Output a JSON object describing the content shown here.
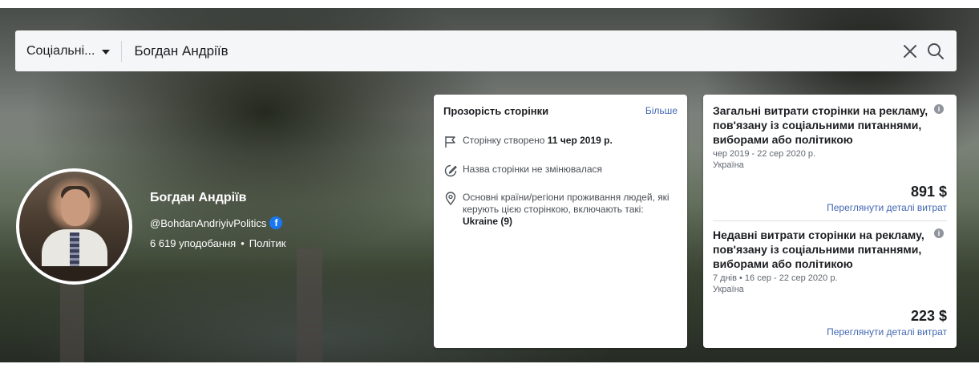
{
  "search": {
    "category": "Соціальні...",
    "query": "Богдан Андріїв"
  },
  "profile": {
    "name": "Богдан Андріїв",
    "handle": "@BohdanAndriyivPolitics",
    "likes": "6 619 уподобання",
    "separator": "•",
    "category": "Політик"
  },
  "transparency": {
    "title": "Прозорість сторінки",
    "more_label": "Більше",
    "created_prefix": "Сторінку створено",
    "created_date": "11 чер 2019 р.",
    "name_unchanged": "Назва сторінки не змінювалася",
    "countries_text": "Основні країни/регіони проживання людей, які керують цією сторінкою, включають такі:",
    "countries_value": "Ukraine (9)"
  },
  "spend": {
    "total": {
      "title": "Загальні витрати сторінки на рекламу, пов'язану із соціальними питаннями, виборами або політикою",
      "period": "чер 2019 - 22 сер 2020 р.",
      "country": "Україна",
      "amount": "891 $",
      "link": "Переглянути деталі витрат"
    },
    "recent": {
      "title": "Недавні витрати сторінки на рекламу, пов'язану із соціальними питаннями, виборами або політикою",
      "period": "7 днів • 16 сер - 22 сер 2020 р.",
      "country": "Україна",
      "amount": "223 $",
      "link": "Переглянути деталі витрат"
    },
    "info_icon": "i"
  },
  "icons": {
    "clear": "close-icon",
    "search": "search-icon",
    "facebook": "facebook-icon",
    "facebook_glyph": "f",
    "flag": "flag-icon",
    "edit": "edit-icon",
    "location": "location-pin-icon",
    "info": "info-icon"
  },
  "colors": {
    "link": "#4267b2",
    "facebook_blue": "#1877f2",
    "card_bg": "#ffffff",
    "search_bg": "#f5f6f7"
  }
}
